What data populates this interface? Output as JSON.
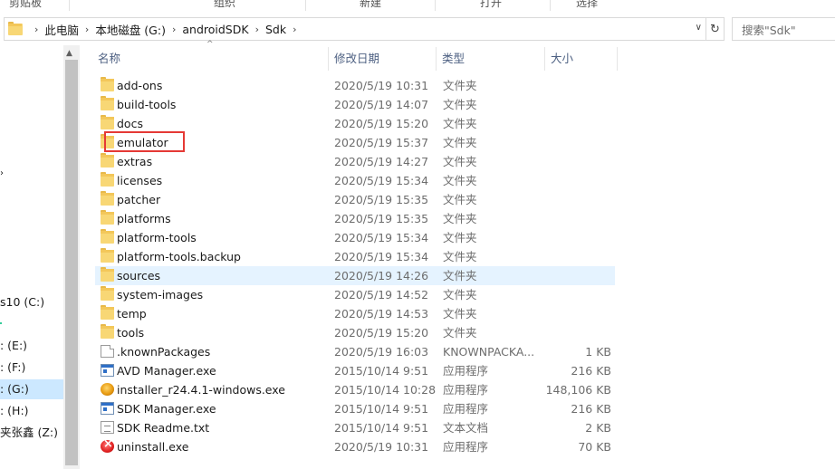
{
  "ribbon": {
    "groups": [
      "剪贴板",
      "组织",
      "新建",
      "打开",
      "选择"
    ]
  },
  "address_bar": {
    "crumbs": [
      "此电脑",
      "本地磁盘 (G:)",
      "androidSDK",
      "Sdk"
    ]
  },
  "search": {
    "placeholder": "搜索\"Sdk\""
  },
  "nav_pane": {
    "items": [
      {
        "label": "s10 (C:)"
      },
      {
        "label": ": (E:)"
      },
      {
        "label": ": (F:)"
      },
      {
        "label": ": (G:)",
        "selected": true
      },
      {
        "label": ": (H:)"
      },
      {
        "label": "夹张鑫 (Z:)"
      }
    ]
  },
  "columns": {
    "name": "名称",
    "date": "修改日期",
    "type": "类型",
    "size": "大小"
  },
  "files": [
    {
      "name": "add-ons",
      "date": "2020/5/19 10:31",
      "type": "文件夹",
      "size": "",
      "icon": "folder-icon"
    },
    {
      "name": "build-tools",
      "date": "2020/5/19 14:07",
      "type": "文件夹",
      "size": "",
      "icon": "folder-icon"
    },
    {
      "name": "docs",
      "date": "2020/5/19 15:20",
      "type": "文件夹",
      "size": "",
      "icon": "folder-icon"
    },
    {
      "name": "emulator",
      "date": "2020/5/19 15:37",
      "type": "文件夹",
      "size": "",
      "icon": "folder-icon"
    },
    {
      "name": "extras",
      "date": "2020/5/19 14:27",
      "type": "文件夹",
      "size": "",
      "icon": "folder-icon"
    },
    {
      "name": "licenses",
      "date": "2020/5/19 15:34",
      "type": "文件夹",
      "size": "",
      "icon": "folder-icon"
    },
    {
      "name": "patcher",
      "date": "2020/5/19 15:35",
      "type": "文件夹",
      "size": "",
      "icon": "folder-icon"
    },
    {
      "name": "platforms",
      "date": "2020/5/19 15:35",
      "type": "文件夹",
      "size": "",
      "icon": "folder-icon"
    },
    {
      "name": "platform-tools",
      "date": "2020/5/19 15:34",
      "type": "文件夹",
      "size": "",
      "icon": "folder-icon"
    },
    {
      "name": "platform-tools.backup",
      "date": "2020/5/19 15:34",
      "type": "文件夹",
      "size": "",
      "icon": "folder-icon"
    },
    {
      "name": "sources",
      "date": "2020/5/19 14:26",
      "type": "文件夹",
      "size": "",
      "icon": "folder-icon"
    },
    {
      "name": "system-images",
      "date": "2020/5/19 14:52",
      "type": "文件夹",
      "size": "",
      "icon": "folder-icon"
    },
    {
      "name": "temp",
      "date": "2020/5/19 14:53",
      "type": "文件夹",
      "size": "",
      "icon": "folder-icon"
    },
    {
      "name": "tools",
      "date": "2020/5/19 15:20",
      "type": "文件夹",
      "size": "",
      "icon": "folder-icon"
    },
    {
      "name": ".knownPackages",
      "date": "2020/5/19 16:03",
      "type": "KNOWNPACKA...",
      "size": "1 KB",
      "icon": "file-icon"
    },
    {
      "name": "AVD Manager.exe",
      "date": "2015/10/14 9:51",
      "type": "应用程序",
      "size": "216 KB",
      "icon": "app-icon"
    },
    {
      "name": "installer_r24.4.1-windows.exe",
      "date": "2015/10/14 10:28",
      "type": "应用程序",
      "size": "148,106 KB",
      "icon": "installer-icon"
    },
    {
      "name": "SDK Manager.exe",
      "date": "2015/10/14 9:51",
      "type": "应用程序",
      "size": "216 KB",
      "icon": "app-icon"
    },
    {
      "name": "SDK Readme.txt",
      "date": "2015/10/14 9:51",
      "type": "文本文档",
      "size": "2 KB",
      "icon": "text-file-icon"
    },
    {
      "name": "uninstall.exe",
      "date": "2020/5/19 10:31",
      "type": "应用程序",
      "size": "70 KB",
      "icon": "uninstall-icon"
    }
  ],
  "hovered_row": "sources",
  "highlighted_item": "emulator"
}
